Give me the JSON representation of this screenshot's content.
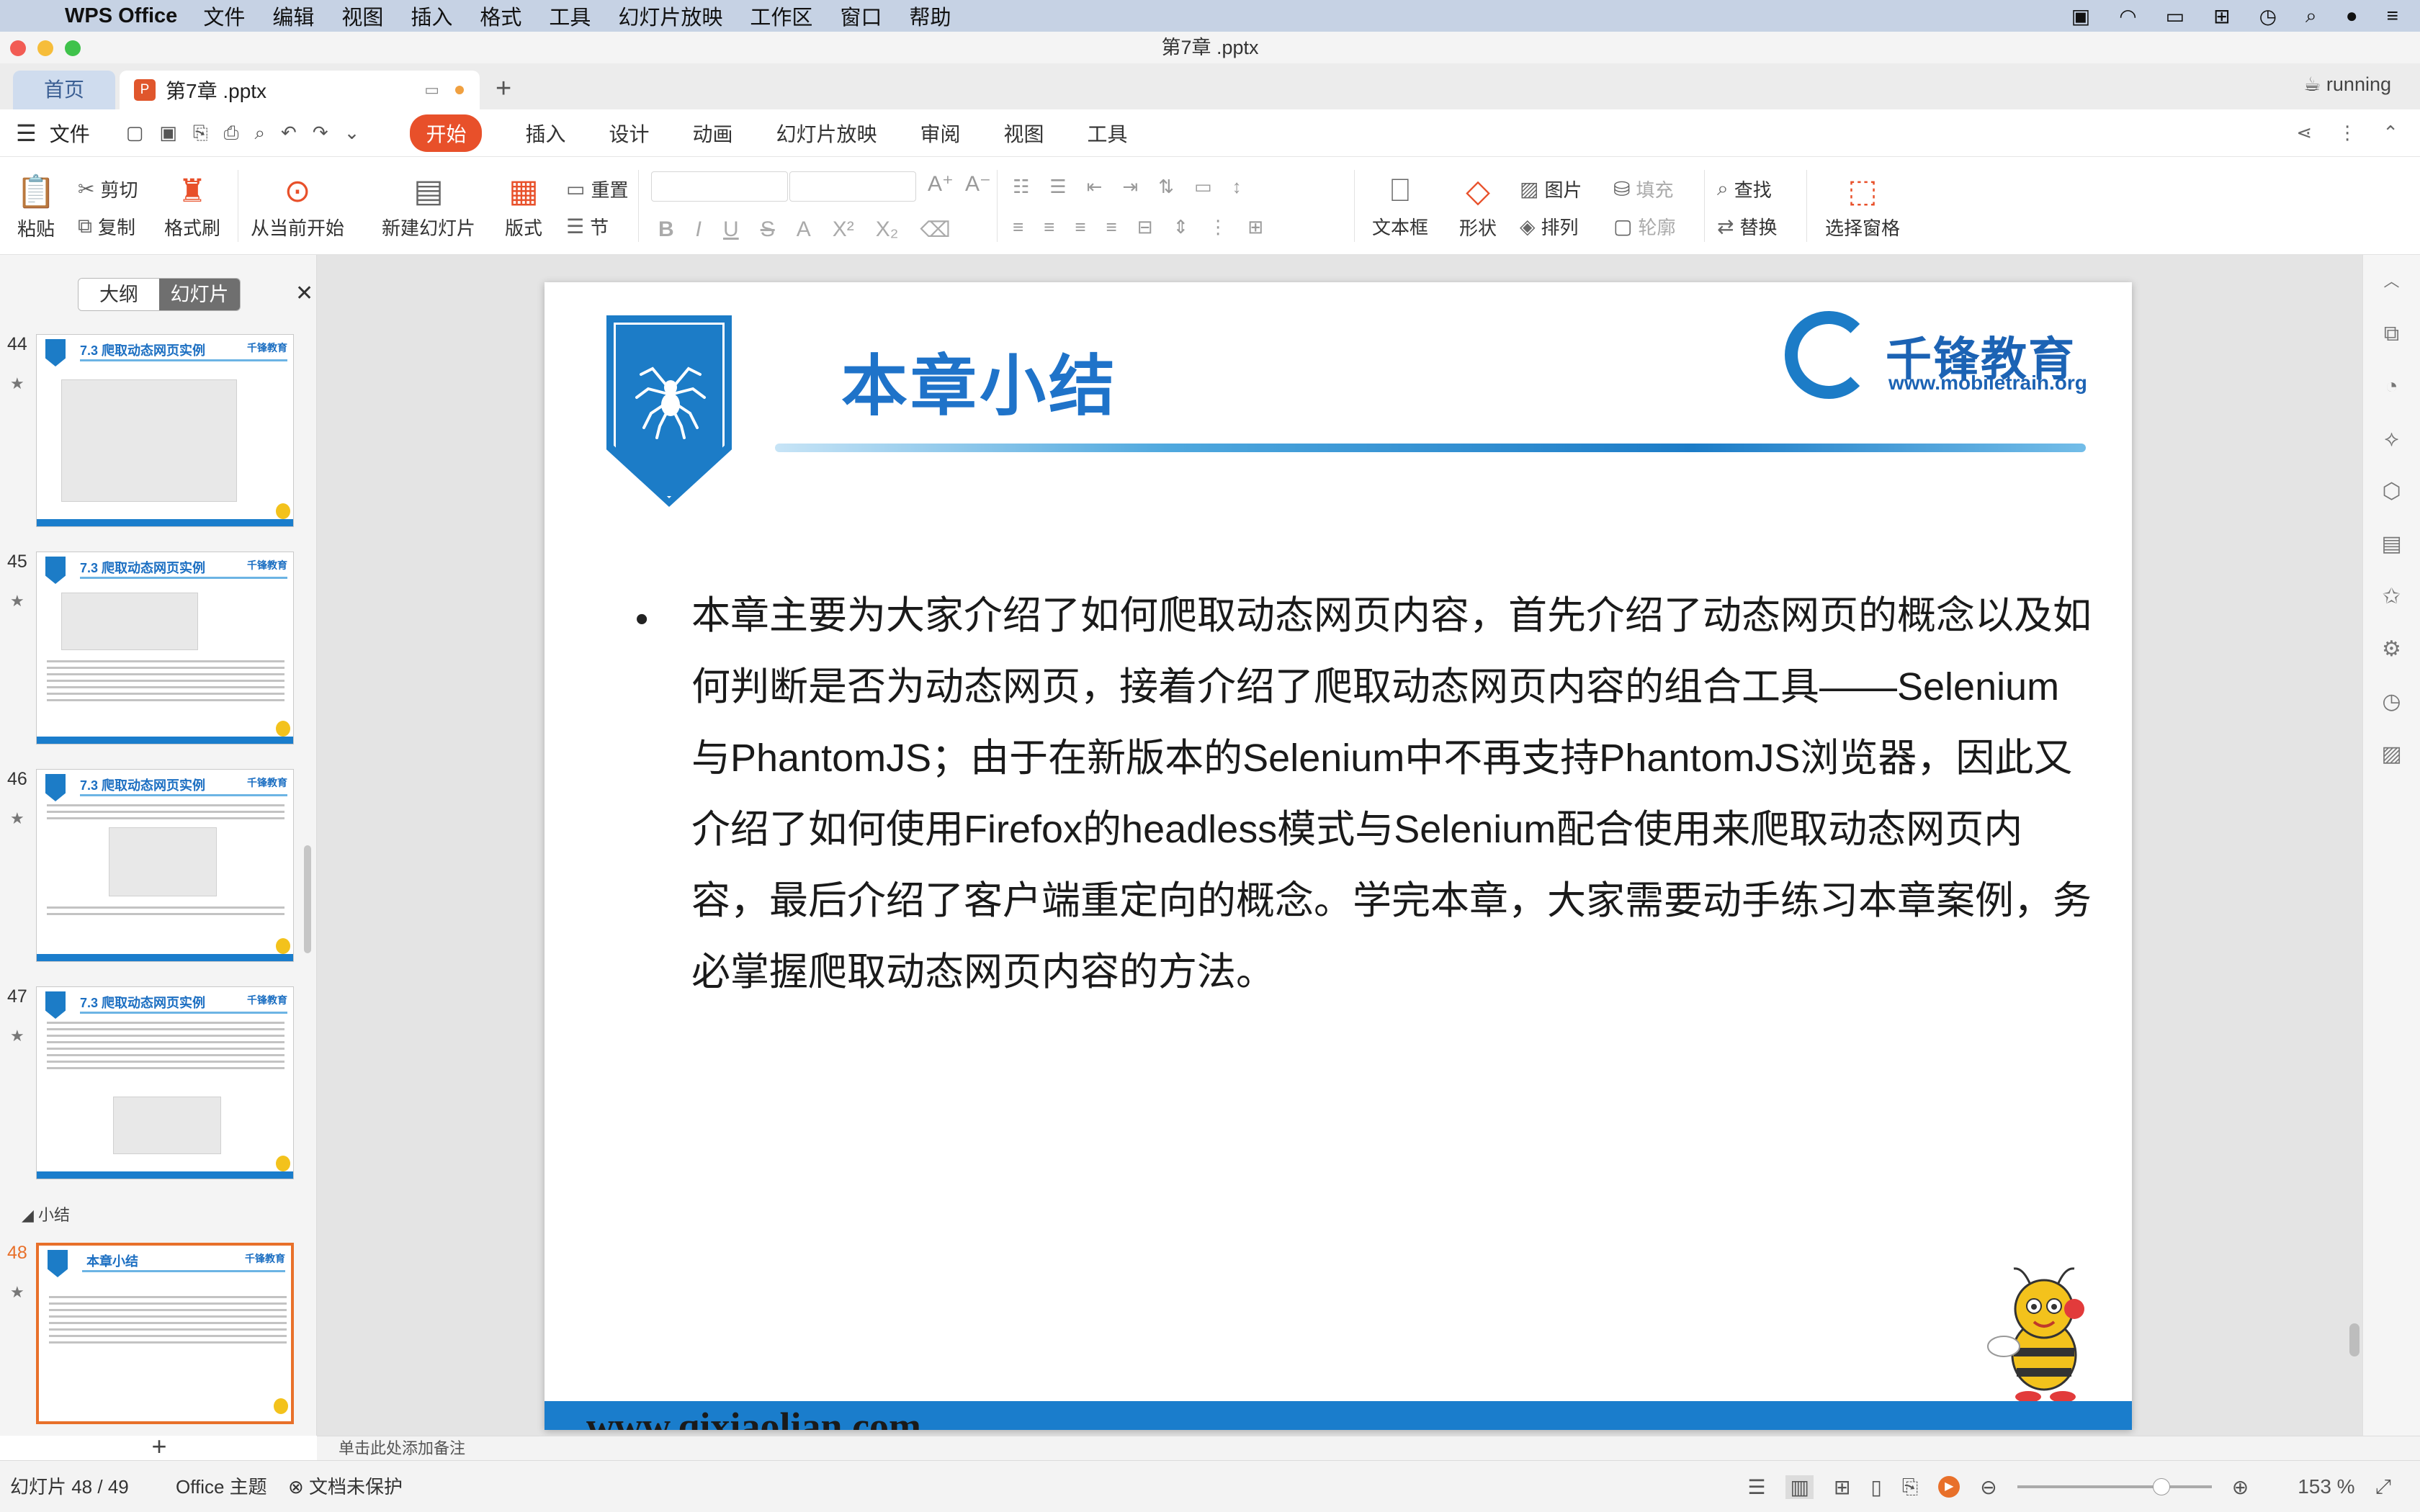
{
  "menubar": {
    "app_name": "WPS Office",
    "items": [
      "文件",
      "编辑",
      "视图",
      "插入",
      "格式",
      "工具",
      "幻灯片放映",
      "工作区",
      "窗口",
      "帮助"
    ]
  },
  "window": {
    "title": "第7章 .pptx"
  },
  "tabs": {
    "home": "首页",
    "document": "第7章 .pptx",
    "running": "running"
  },
  "ribbon_tabs": {
    "file": "文件",
    "items": [
      {
        "label": "开始",
        "active": true
      },
      {
        "label": "插入"
      },
      {
        "label": "设计"
      },
      {
        "label": "动画"
      },
      {
        "label": "幻灯片放映"
      },
      {
        "label": "审阅"
      },
      {
        "label": "视图"
      },
      {
        "label": "工具"
      }
    ]
  },
  "ribbon": {
    "paste": "粘贴",
    "cut": "剪切",
    "copy": "复制",
    "format_painter": "格式刷",
    "play_from_current": "从当前开始",
    "new_slide": "新建幻灯片",
    "layout": "版式",
    "reset": "重置",
    "section": "节",
    "text_box": "文本框",
    "shape": "形状",
    "picture": "图片",
    "fill": "填充",
    "arrange": "排列",
    "outline": "轮廓",
    "find": "查找",
    "replace": "替换",
    "select_pane": "选择窗格"
  },
  "left_panel": {
    "tab_outline": "大纲",
    "tab_slides": "幻灯片",
    "section_label": "小结",
    "thumbnails": [
      {
        "number": "44",
        "title": "7.3 爬取动态网页实例"
      },
      {
        "number": "45",
        "title": "7.3 爬取动态网页实例"
      },
      {
        "number": "46",
        "title": "7.3 爬取动态网页实例"
      },
      {
        "number": "47",
        "title": "7.3 爬取动态网页实例"
      },
      {
        "number": "48",
        "title": "本章小结",
        "selected": true
      }
    ]
  },
  "slide": {
    "title": "本章小结",
    "logo_cn": "千锋教育",
    "logo_url": "www.mobiletrain.org",
    "bullet": "•",
    "body": "本章主要为大家介绍了如何爬取动态网页内容，首先介绍了动态网页的概念以及如何判断是否为动态网页，接着介绍了爬取动态网页内容的组合工具——Selenium与PhantomJS；由于在新版本的Selenium中不再支持PhantomJS浏览器，因此又介绍了如何使用Firefox的headless模式与Selenium配合使用来爬取动态网页内容，最后介绍了客户端重定向的概念。学完本章，大家需要动手练习本章案例，务必掌握爬取动态网页内容的方法。",
    "footer_url": "www.qixiaolian.com"
  },
  "notes": {
    "placeholder": "单击此处添加备注"
  },
  "status": {
    "slide_counter": "幻灯片 48 / 49",
    "theme": "Office 主题",
    "protection": "文档未保护",
    "zoom": "153 %",
    "zoom_fraction": 0.74
  },
  "colors": {
    "accent": "#e8502a",
    "brand_blue": "#1c7cc7",
    "selection": "#e8702a"
  }
}
